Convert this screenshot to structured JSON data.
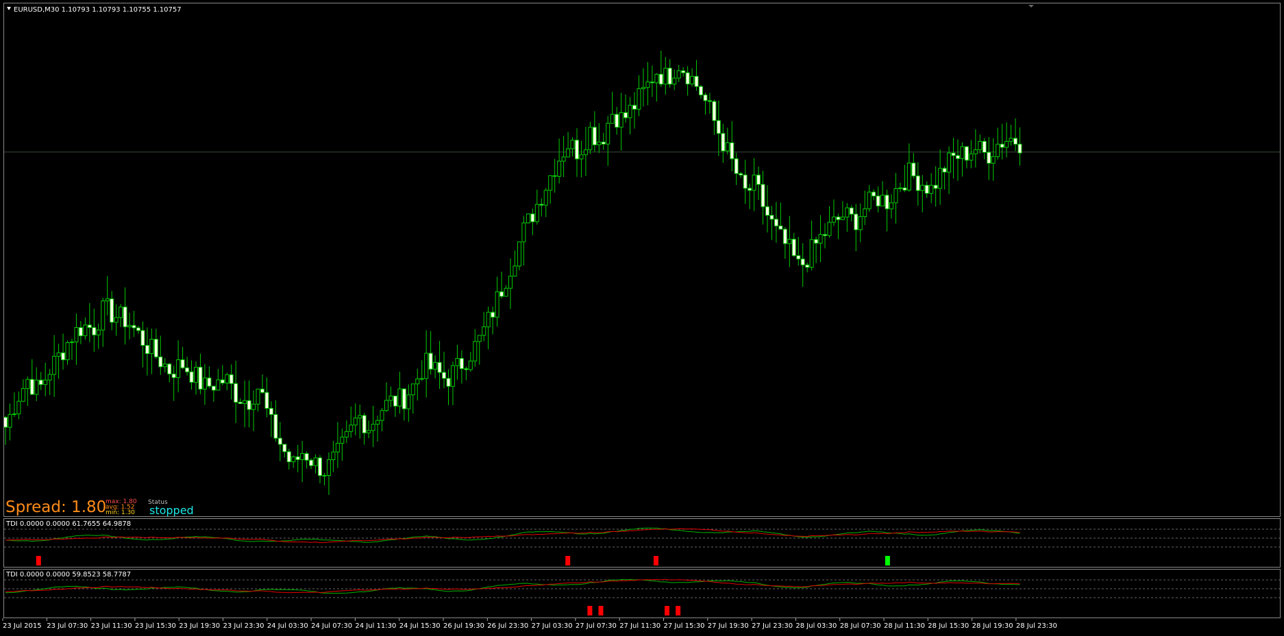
{
  "chart_title": "EURUSD,M30  1.10793 1.10793 1.10755 1.10757",
  "spread": {
    "label": "Spread: 1.80",
    "max": "max: 1.80",
    "avg": "avg: 1.52",
    "min": "min: 1.30",
    "status_label": "Status",
    "status_value": "stopped"
  },
  "indicators": [
    {
      "title": "TDI 0.0000 0.0000 61.7655 64.9878"
    },
    {
      "title": "TDI 0.0000 0.0000 59.8523 58.7787"
    }
  ],
  "time_labels": [
    "23 Jul 2015",
    "23 Jul 07:30",
    "23 Jul 11:30",
    "23 Jul 15:30",
    "23 Jul 19:30",
    "23 Jul 23:30",
    "24 Jul 03:30",
    "24 Jul 07:30",
    "24 Jul 11:30",
    "24 Jul 15:30",
    "26 Jul 19:30",
    "26 Jul 23:30",
    "27 Jul 03:30",
    "27 Jul 07:30",
    "27 Jul 11:30",
    "27 Jul 15:30",
    "27 Jul 19:30",
    "27 Jul 23:30",
    "28 Jul 03:30",
    "28 Jul 07:30",
    "28 Jul 11:30",
    "28 Jul 15:30",
    "28 Jul 19:30",
    "28 Jul 23:30"
  ],
  "colors": {
    "background": "#000000",
    "bull_candle": "#000000",
    "bear_candle": "#ffffe6",
    "wick": "#00cc00",
    "grid": "#3a4a3a",
    "spread": "#ff8c1a",
    "status": "#1ee6e6",
    "tdi_green": "#00b300",
    "tdi_red": "#e60000",
    "signal_red": "#ff0000",
    "signal_green": "#00ff00"
  },
  "chart_data": {
    "type": "candlestick",
    "symbol": "EURUSD",
    "timeframe": "M30",
    "close_series": [
      1.099,
      1.1004,
      1.1014,
      1.1008,
      1.1019,
      1.1027,
      1.1036,
      1.1041,
      1.104,
      1.105,
      1.1046,
      1.1044,
      1.1037,
      1.103,
      1.1024,
      1.1018,
      1.1022,
      1.1017,
      1.101,
      1.1012,
      1.1014,
      1.1006,
      1.1003,
      1.1011,
      1.0992,
      1.0981,
      1.097,
      1.0978,
      1.0972,
      1.0968,
      1.0975,
      1.0984,
      1.0996,
      1.099,
      1.0999,
      1.1003,
      1.1004,
      1.1011,
      1.1022,
      1.1018,
      1.1014,
      1.102,
      1.1026,
      1.1034,
      1.1046,
      1.106,
      1.1074,
      1.1089,
      1.11,
      1.1112,
      1.1124,
      1.1133,
      1.1129,
      1.114,
      1.1134,
      1.1149,
      1.1145,
      1.1152,
      1.116,
      1.117,
      1.1166,
      1.1174,
      1.1168,
      1.116,
      1.1148,
      1.1135,
      1.1122,
      1.1108,
      1.1112,
      1.1098,
      1.1087,
      1.108,
      1.107,
      1.1078,
      1.1086,
      1.1092,
      1.1097,
      1.1094,
      1.1101,
      1.1106,
      1.1104,
      1.1112,
      1.1118,
      1.1114,
      1.111,
      1.112,
      1.1126,
      1.1128,
      1.1131,
      1.1127,
      1.1133,
      1.1136,
      1.1134
    ],
    "signals_panel1": [
      {
        "index": 3,
        "dir": "down"
      },
      {
        "index": 51,
        "dir": "down"
      },
      {
        "index": 59,
        "dir": "down"
      },
      {
        "index": 80,
        "dir": "up"
      }
    ],
    "signals_panel2": [
      {
        "index": 53,
        "dir": "down"
      },
      {
        "index": 54,
        "dir": "down"
      },
      {
        "index": 60,
        "dir": "down"
      },
      {
        "index": 61,
        "dir": "down"
      }
    ]
  }
}
